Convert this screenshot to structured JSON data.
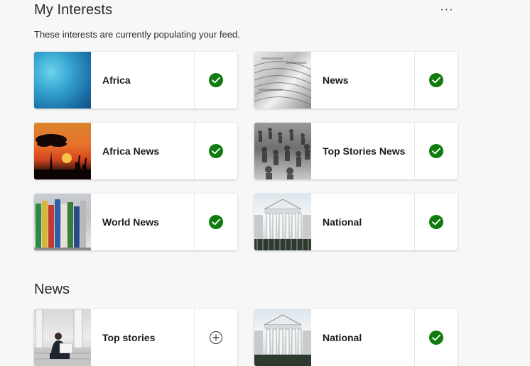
{
  "header": {
    "title": "My Interests",
    "subtitle": "These interests are currently populating your feed.",
    "more_label": "···"
  },
  "colors": {
    "check": "#107c10",
    "background": "#f7f7f7"
  },
  "interests": [
    {
      "label": "Africa",
      "thumb": "abstract-blue-image",
      "followed": true
    },
    {
      "label": "News",
      "thumb": "newspaper-stack-image",
      "followed": true
    },
    {
      "label": "Africa News",
      "thumb": "sunset-savanna-image",
      "followed": true
    },
    {
      "label": "Top Stories News",
      "thumb": "crowd-image",
      "followed": true
    },
    {
      "label": "World News",
      "thumb": "flags-image",
      "followed": true
    },
    {
      "label": "National",
      "thumb": "parliament-building-image",
      "followed": true
    }
  ],
  "news_section": {
    "title": "News",
    "items": [
      {
        "label": "Top stories",
        "thumb": "man-reading-newspaper-image",
        "followed": false
      },
      {
        "label": "National",
        "thumb": "parliament-building-image",
        "followed": true
      }
    ]
  }
}
